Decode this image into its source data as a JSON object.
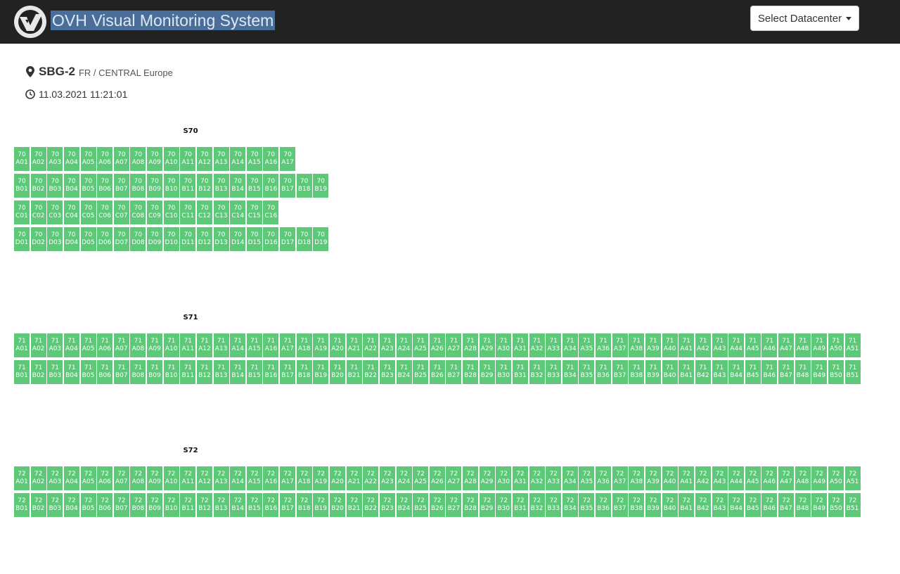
{
  "header": {
    "title": "OVH Visual Monitoring System",
    "logo_icon": "ovh-logo-icon",
    "datacenter_button": "Select Datacenter",
    "background": "#222222",
    "title_highlight": "#4a6e9a"
  },
  "site": {
    "name": "SBG-2",
    "region": "FR / CENTRAL Europe",
    "timestamp": "11.03.2021 11:21:01",
    "location_icon": "map-marker-icon",
    "clock_icon": "clock-icon"
  },
  "status_colors": {
    "ok": "#5cc878"
  },
  "sections": [
    {
      "name": "S70",
      "number": "70",
      "rows": [
        {
          "letter": "A",
          "count": 17
        },
        {
          "letter": "B",
          "count": 19
        },
        {
          "letter": "C",
          "count": 16
        },
        {
          "letter": "D",
          "count": 19
        }
      ]
    },
    {
      "name": "S71",
      "number": "71",
      "rows": [
        {
          "letter": "A",
          "count": 51
        },
        {
          "letter": "B",
          "count": 51
        }
      ]
    },
    {
      "name": "S72",
      "number": "72",
      "rows": [
        {
          "letter": "A",
          "count": 51
        },
        {
          "letter": "B",
          "count": 51
        }
      ]
    }
  ]
}
